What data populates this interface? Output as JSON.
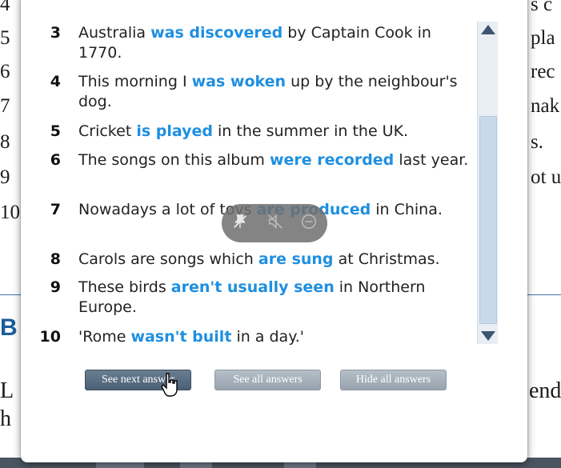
{
  "background": {
    "line_numbers": [
      "4",
      "5",
      "6",
      "7",
      "8",
      "9",
      "10"
    ],
    "right_fragments": [
      "s c",
      "pla",
      "rec",
      "nak",
      "s.",
      "ot u"
    ],
    "heading_fragment": "B",
    "left_letters": [
      "L",
      "h"
    ],
    "right_bottom_fragment": "end"
  },
  "exercise": {
    "items": [
      {
        "num": "3",
        "before": "Australia ",
        "answer": "was discovered",
        "after": " by Captain Cook in 1770."
      },
      {
        "num": "4",
        "before": "This morning I ",
        "answer": "was woken",
        "after": " up by the neighbour's dog."
      },
      {
        "num": "5",
        "before": "Cricket ",
        "answer": "is played",
        "after": " in the summer in the UK."
      },
      {
        "num": "6",
        "before": "The songs on this album ",
        "answer": "were recorded",
        "after": " last year."
      },
      {
        "num": "7",
        "before": "Nowadays a lot of toys ",
        "answer": "are produced",
        "after": " in China."
      },
      {
        "num": "8",
        "before": "Carols are songs which ",
        "answer": "are sung",
        "after": " at Christmas."
      },
      {
        "num": "9",
        "before": "These birds ",
        "answer": "aren't usually seen",
        "after": " in Northern Europe."
      },
      {
        "num": "10",
        "before": "'Rome ",
        "answer": "wasn't built",
        "after": " in a day.'"
      }
    ]
  },
  "buttons": {
    "next": "See next answer",
    "all": "See all answers",
    "hide": "Hide all answers"
  },
  "media_controls": {
    "icons": [
      "pin-off-icon",
      "mute-icon",
      "minus-circle-icon"
    ],
    "glyphs": [
      "⚲",
      "🔇",
      "⊖"
    ]
  },
  "colors": {
    "answer": "#1f8fe0",
    "heading": "#1a5d9c"
  }
}
